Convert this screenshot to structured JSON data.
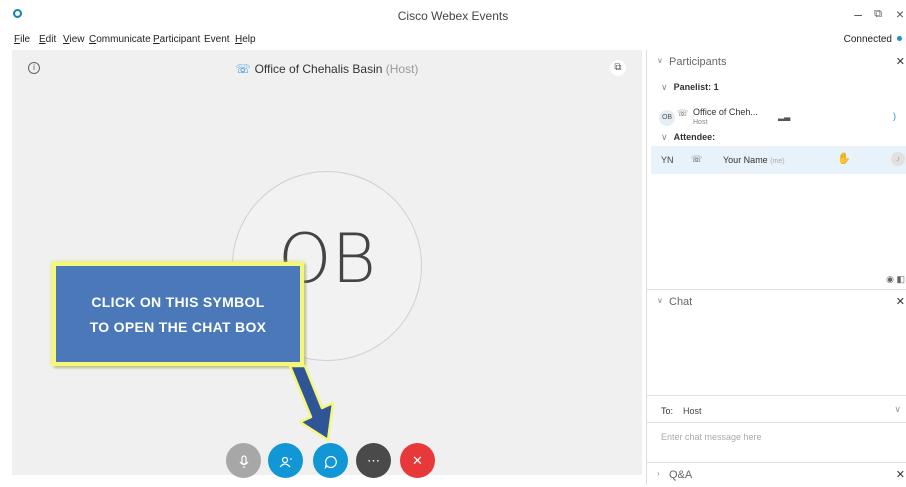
{
  "window": {
    "title": "Cisco Webex Events",
    "status": "Connected"
  },
  "menu": [
    {
      "first": "F",
      "rest": "ile"
    },
    {
      "first": "E",
      "rest": "dit"
    },
    {
      "first": "V",
      "rest": "iew"
    },
    {
      "first": "C",
      "rest": "ommunicate"
    },
    {
      "first": "P",
      "rest": "articipant"
    },
    {
      "first": "",
      "rest": "Event"
    },
    {
      "first": "H",
      "rest": "elp"
    }
  ],
  "stage": {
    "host_name": "Office of Chehalis Basin",
    "host_tag": "(Host)",
    "avatar_initials": "OB"
  },
  "callout": {
    "line1": "CLICK ON THIS SYMBOL",
    "line2": "TO OPEN THE CHAT BOX",
    "arrow_color": "#2f5597",
    "highlight_color": "#f4f77a"
  },
  "participants": {
    "title": "Participants",
    "panelist_group": "Panelist: 1",
    "host": {
      "initials": "OB",
      "name": "Office of Cheh...",
      "role": "Host"
    },
    "attendee_group": "Attendee:",
    "attendee": {
      "initials": "YN",
      "name": "Your Name",
      "tag": "(me)"
    }
  },
  "chat": {
    "title": "Chat",
    "to_label": "To:",
    "to_value": "Host",
    "placeholder": "Enter chat message here"
  },
  "qa": {
    "title": "Q&A"
  },
  "colors": {
    "accent": "#1196d6",
    "leave": "#e8393a",
    "callout_bg": "#4a78b8"
  }
}
